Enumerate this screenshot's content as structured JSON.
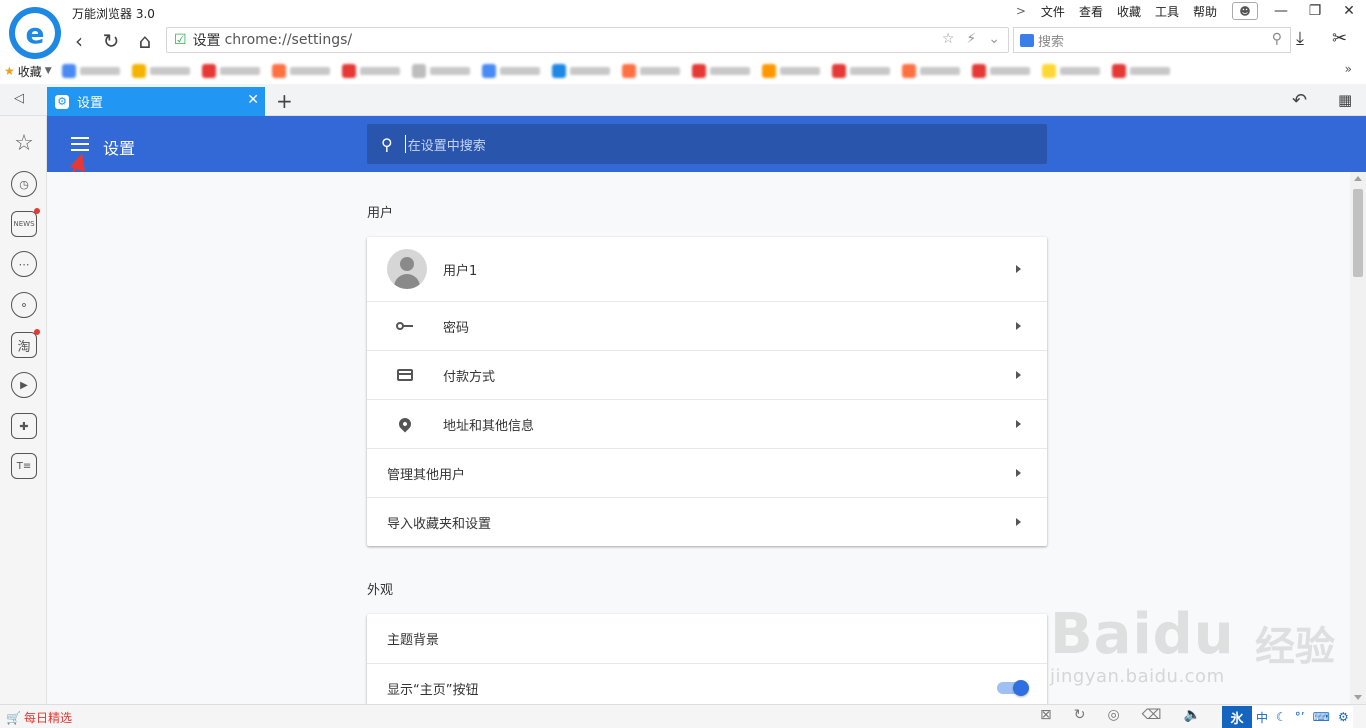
{
  "titlebar": {
    "app_title": "万能浏览器 3.0",
    "menus": [
      "文件",
      "查看",
      "收藏",
      "工具",
      "帮助"
    ]
  },
  "navbar": {
    "address_label": "设置",
    "address_url": "chrome://settings/",
    "search_placeholder": "搜索"
  },
  "bookmarks": {
    "favorites_label": "收藏",
    "item_colors": [
      "#4a8af4",
      "#f4b400",
      "#e53935",
      "#ff7043",
      "#e53935",
      "#bdbdbd",
      "#4a8af4",
      "#1e88e5",
      "#ff7043",
      "#e53935",
      "#ff9800",
      "#e53935",
      "#ff7043",
      "#e53935",
      "#fdd835",
      "#e53935"
    ]
  },
  "tabs": [
    {
      "label": "设置",
      "active": true
    }
  ],
  "settings": {
    "header_title": "设置",
    "search_placeholder": "在设置中搜索",
    "sections": [
      {
        "title": "用户",
        "rows": [
          {
            "label": "用户1",
            "type": "avatar"
          },
          {
            "label": "密码",
            "type": "key"
          },
          {
            "label": "付款方式",
            "type": "card"
          },
          {
            "label": "地址和其他信息",
            "type": "pin"
          },
          {
            "label": "管理其他用户",
            "type": "plain"
          },
          {
            "label": "导入收藏夹和设置",
            "type": "plain"
          }
        ]
      },
      {
        "title": "外观",
        "rows": [
          {
            "label": "主题背景",
            "type": "plain"
          },
          {
            "label": "显示“主页”按钮",
            "type": "toggle",
            "enabled": true
          }
        ]
      }
    ]
  },
  "statusbar": {
    "daily_label": "每日精选",
    "ime": {
      "main": "氷",
      "lang": "中"
    }
  },
  "watermark": {
    "brand": "Baidu",
    "brand_cn": "经验",
    "url": "jingyan.baidu.com"
  },
  "colors": {
    "accent": "#3369d6",
    "tab": "#2196f3",
    "annotation": "#e53935"
  }
}
